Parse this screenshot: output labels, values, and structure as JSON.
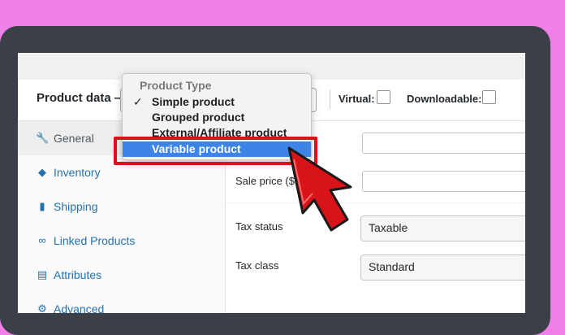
{
  "header": {
    "title": "Product data —",
    "virtual_label": "Virtual:",
    "downloadable_label": "Downloadable:"
  },
  "dropdown": {
    "group_label": "Product Type",
    "options": [
      {
        "label": "Simple product",
        "checked": "✓"
      },
      {
        "label": "Grouped product"
      },
      {
        "label": "External/Affiliate product"
      },
      {
        "label": "Variable product"
      }
    ]
  },
  "sidebar": {
    "items": [
      {
        "label": "General",
        "icon": "wrench-icon"
      },
      {
        "label": "Inventory",
        "icon": "tag-icon"
      },
      {
        "label": "Shipping",
        "icon": "truck-icon"
      },
      {
        "label": "Linked Products",
        "icon": "link-icon"
      },
      {
        "label": "Attributes",
        "icon": "list-icon"
      },
      {
        "label": "Advanced",
        "icon": "gear-icon"
      }
    ]
  },
  "fields": {
    "sale_price_label": "Sale price ($",
    "tax_status_label": "Tax status",
    "tax_status_value": "Taxable",
    "tax_class_label": "Tax class",
    "tax_class_value": "Standard"
  },
  "colors": {
    "background": "#ef7fe9",
    "highlight": "#3d84e6",
    "annotation": "#d9131a",
    "link": "#2271b1"
  }
}
